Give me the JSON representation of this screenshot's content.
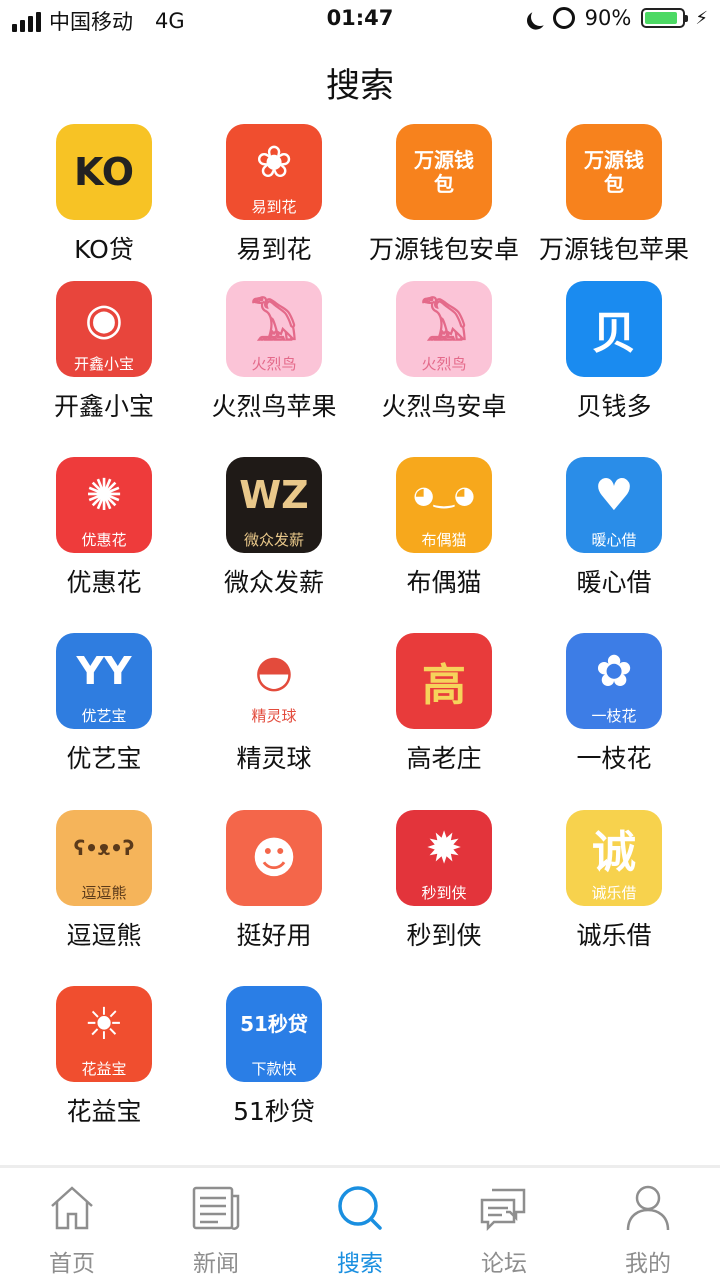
{
  "status_bar": {
    "carrier": "中国移动",
    "network": "4G",
    "time": "01:47",
    "battery": "90%"
  },
  "title": "搜索",
  "apps": [
    {
      "label": "KO贷",
      "icon_text": "KO",
      "band": "",
      "bg": "#f7c325",
      "fg": "#222"
    },
    {
      "label": "易到花",
      "icon_text": "❀",
      "band": "易到花",
      "bg": "#f04e2f",
      "fg": "#fff"
    },
    {
      "label": "万源钱包安卓",
      "icon_text": "万源钱包",
      "band": "",
      "bg": "#f7821d",
      "fg": "#fff"
    },
    {
      "label": "万源钱包苹果",
      "icon_text": "万源钱包",
      "band": "",
      "bg": "#f7821d",
      "fg": "#fff"
    },
    {
      "label": "开鑫小宝",
      "icon_text": "◉",
      "band": "开鑫小宝",
      "bg": "#e8453c",
      "fg": "#fff"
    },
    {
      "label": "火烈鸟苹果",
      "icon_text": "𓅐",
      "band": "火烈鸟",
      "bg": "#fbc4d7",
      "fg": "#e46a8a"
    },
    {
      "label": "火烈鸟安卓",
      "icon_text": "𓅐",
      "band": "火烈鸟",
      "bg": "#fbc4d7",
      "fg": "#e46a8a"
    },
    {
      "label": "贝钱多",
      "icon_text": "贝",
      "band": "",
      "bg": "#1a8bf0",
      "fg": "#fff"
    },
    {
      "label": "优惠花",
      "icon_text": "✺",
      "band": "优惠花",
      "bg": "#ee3b3b",
      "fg": "#fff"
    },
    {
      "label": "微众发薪",
      "icon_text": "WZ",
      "band": "微众发薪",
      "bg": "#1f1a17",
      "fg": "#e9c88a"
    },
    {
      "label": "布偶猫",
      "icon_text": "◕‿◕",
      "band": "布偶猫",
      "bg": "#f7a81c",
      "fg": "#fff"
    },
    {
      "label": "暖心借",
      "icon_text": "♥",
      "band": "暖心借",
      "bg": "#2a8de8",
      "fg": "#fff"
    },
    {
      "label": "优艺宝",
      "icon_text": "YY",
      "band": "优艺宝",
      "bg": "#2f7de0",
      "fg": "#fff"
    },
    {
      "label": "精灵球",
      "icon_text": "◓",
      "band": "精灵球",
      "bg": "#ffffff",
      "fg": "#e34b3c"
    },
    {
      "label": "高老庄",
      "icon_text": "高",
      "band": "",
      "bg": "#e83b3b",
      "fg": "#f6d35b"
    },
    {
      "label": "一枝花",
      "icon_text": "✿",
      "band": "一枝花",
      "bg": "#3d7de6",
      "fg": "#fff"
    },
    {
      "label": "逗逗熊",
      "icon_text": "ʕ•ᴥ•ʔ",
      "band": "逗逗熊",
      "bg": "#f5b45a",
      "fg": "#5b3a1a"
    },
    {
      "label": "挺好用",
      "icon_text": "☻",
      "band": "",
      "bg": "#f4664a",
      "fg": "#fff"
    },
    {
      "label": "秒到侠",
      "icon_text": "✹",
      "band": "秒到侠",
      "bg": "#e3343b",
      "fg": "#fff"
    },
    {
      "label": "诚乐借",
      "icon_text": "诚",
      "band": "诚乐借",
      "bg": "#f7d24d",
      "fg": "#fff"
    },
    {
      "label": "花益宝",
      "icon_text": "☀",
      "band": "花益宝",
      "bg": "#f04e2f",
      "fg": "#fff"
    },
    {
      "label": "51秒贷",
      "icon_text": "51秒贷",
      "band": "下款快",
      "bg": "#2a7ee6",
      "fg": "#fff"
    }
  ],
  "tabs": [
    {
      "label": "首页",
      "icon": "home-icon",
      "active": false
    },
    {
      "label": "新闻",
      "icon": "news-icon",
      "active": false
    },
    {
      "label": "搜索",
      "icon": "search-icon",
      "active": true
    },
    {
      "label": "论坛",
      "icon": "forum-icon",
      "active": false
    },
    {
      "label": "我的",
      "icon": "profile-icon",
      "active": false
    }
  ],
  "colors": {
    "accent": "#1a8fe0",
    "inactive": "#8e8e8e"
  }
}
